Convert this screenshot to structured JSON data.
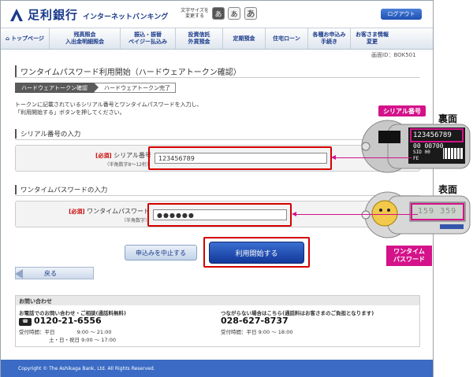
{
  "header": {
    "bank_name": "足利銀行",
    "service_name": "インターネットバンキング",
    "font_size_label": "文字サイズを変更する",
    "font_size_options": [
      "あ",
      "あ",
      "あ"
    ],
    "logout_label": "ログアウト"
  },
  "nav": {
    "items": [
      {
        "label": "トップページ"
      },
      {
        "label": "残高照会\n入出金明細照会"
      },
      {
        "label": "振込・振替\nペイジー払込み"
      },
      {
        "label": "投資信託\n外貨預金"
      },
      {
        "label": "定期預金"
      },
      {
        "label": "住宅ローン"
      },
      {
        "label": "各種お申込み\n手続き"
      },
      {
        "label": "お客さま情報\n変更"
      }
    ]
  },
  "screen_id": "画面ID：BOK501",
  "page_title": "ワンタイムパスワード利用開始（ハードウェアトークン確認）",
  "steps": [
    "ハードウェアトークン確認",
    "ハードウェアトークン完了"
  ],
  "instructions": [
    "トークンに記載されているシリアル番号とワンタイムパスワードを入力し、",
    "「利用開始する」ボタンを押してください。"
  ],
  "serial_section": {
    "heading": "シリアル番号の入力",
    "required": "[必須]",
    "label": "シリアル番号",
    "sub": "（半角数字8～12桁）",
    "value": "123456789"
  },
  "otp_section": {
    "heading": "ワンタイムパスワードの入力",
    "required": "[必須]",
    "label": "ワンタイムパスワード",
    "sub": "（半角数字）",
    "value": "●●●●●●"
  },
  "buttons": {
    "cancel": "申込みを中止する",
    "start": "利用開始する",
    "back": "戻る"
  },
  "contact": {
    "heading": "お問い合わせ",
    "left_title": "お電話でのお問い合わせ・ご相談(通話料無料)",
    "freedial_label": "フリーダイヤル",
    "left_tel": "0120-21-6556",
    "left_hours_1": "受付時間：平日　　　　 9:00 ～ 21:00",
    "left_hours_2": "土・日・祝日 9:00 ～ 17:00",
    "right_title": "つながらない場合はこちら(通話料はお客さまのご負担となります)",
    "right_tel": "028-627-8737",
    "right_hours": "受付時間：平日 9:00 ～ 18:00"
  },
  "footer": {
    "copyright": "Copyright © The Ashikaga Bank, Ltd. All Rights Reserved."
  },
  "annotations": {
    "serial_tag": "シリアル番号",
    "back_side": "裏面",
    "front_side": "表面",
    "token_serial": "123456789",
    "token_back_digits": "00  00700",
    "token_back_code": "SID",
    "token_back_code_2": "00",
    "token_back_code_3": "FE",
    "token_display": "159 359",
    "otp_tag": "ワンタイム\nパスワード",
    "accent_color": "#d4128a"
  }
}
